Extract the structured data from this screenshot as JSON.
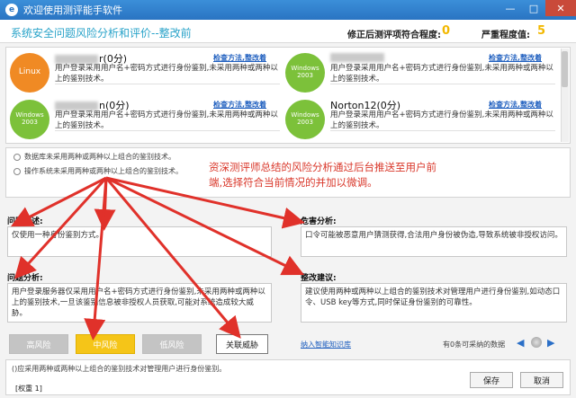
{
  "window": {
    "title": "欢迎使用测评能手软件",
    "minimize_glyph": "—",
    "maximize_glyph": "□",
    "close_glyph": "✕",
    "app_icon_glyph": "e"
  },
  "header": {
    "page_title": "系统安全问题风险分析和评价--整改前",
    "fixed_count_label": "修正后测评项符合程度:",
    "fixed_count_value": "0",
    "severity_label": "严重程度值:",
    "severity_value": "5"
  },
  "cards": [
    {
      "icon": "linux-icon",
      "icon_text": "Linux",
      "name_suffix": "r(0分)",
      "link": "检查方法,整改着",
      "desc": "用户登录采用用户名+密码方式进行身份鉴别,未采用两种或两种以上的鉴别技术。"
    },
    {
      "icon": "windows-icon",
      "icon_text": "Windows 2003",
      "name_suffix": "",
      "link": "检查方法,整改着",
      "desc": "用户登录采用用户名+密码方式进行身份鉴别,未采用两种或两种以上的鉴别技术。"
    },
    {
      "icon": "windows-icon",
      "icon_text": "Windows 2003",
      "name_suffix": "n(0分)",
      "link": "检查方法,整改着",
      "desc": "用户登录采用用户名+密码方式进行身份鉴别,未采用两种或两种以上的鉴别技术。"
    },
    {
      "icon": "windows-icon",
      "icon_text": "Windows 2003",
      "name_suffix": "Norton12(0分)",
      "link": "检查方法,整改着",
      "desc": "用户登录采用用户名+密码方式进行身份鉴别,未采用两种或两种以上的鉴别技术。"
    }
  ],
  "options": [
    "数据库未采用两种或两种以上组合的鉴别技术。",
    "操作系统未采用两种或两种以上组合的鉴别技术。"
  ],
  "annotation": "资深测评师总结的风险分析通过后台推送至用户前端,选择符合当前情况的并加以微调。",
  "problem": {
    "desc_label": "问题描述:",
    "desc_text": "仅使用一种身份鉴别方式。",
    "harm_label": "危害分析:",
    "harm_text": "口令可能被恶意用户猜测获得,合法用户身份被伪造,导致系统被非授权访问。",
    "analysis_label": "问题分析:",
    "analysis_text": "用户登录服务器仅采用用户名+密码方式进行身份鉴别,未采用两种或两种以上的鉴别技术,一旦该鉴别信息被非授权人员获取,可能对系统造成较大威胁。",
    "fix_label": "整改建议:",
    "fix_text": "建议使用两种或两种以上组合的鉴别技术对管理用户进行身份鉴别,如动态口令、USB key等方式,同时保证身份鉴别的可靠性。"
  },
  "risk_buttons": {
    "high": "高风险",
    "mid": "中风险",
    "low": "低风险",
    "close_threat": "关联威胁"
  },
  "kb_link": "纳入智能知识库",
  "count_text": "有0条可采纳的数据",
  "nav": {
    "prev": "◀",
    "next": "▶"
  },
  "footer": {
    "text": "()应采用两种或两种以上组合的鉴别技术对管理用户进行身份鉴别。",
    "weight": "[权重 1]",
    "save": "保存",
    "cancel": "取消"
  },
  "colors": {
    "title_bar": "#2a74c2",
    "accent": "#29a3c9",
    "mid_risk": "#f5c518",
    "annotation": "#d9372a",
    "arrow": "#e0312a"
  }
}
